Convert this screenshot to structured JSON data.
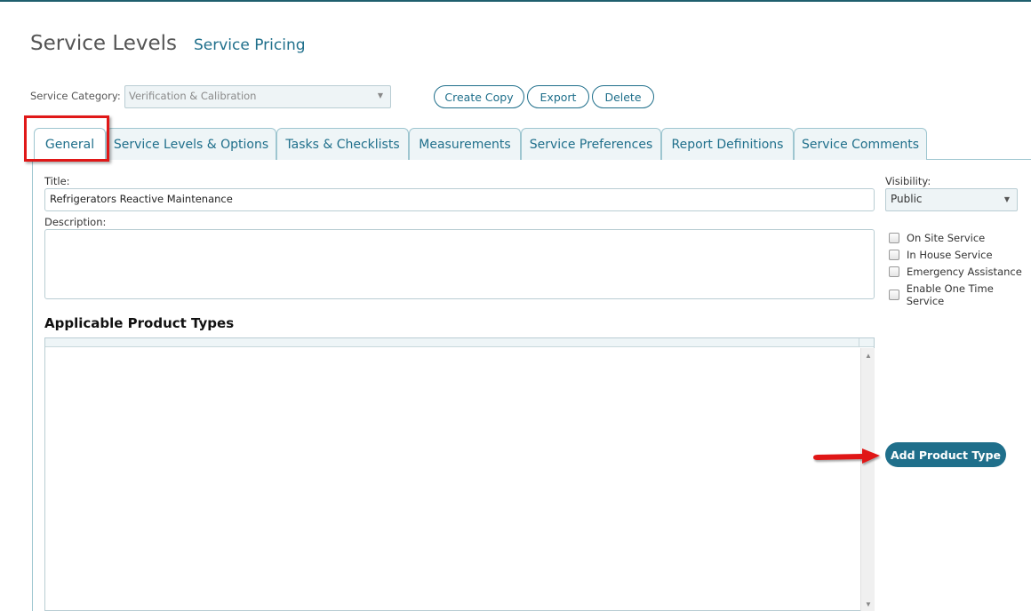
{
  "header": {
    "title": "Service Levels",
    "link": "Service Pricing"
  },
  "category": {
    "label": "Service Category:",
    "value": "Verification & Calibration"
  },
  "actions": {
    "create_copy": "Create Copy",
    "export": "Export",
    "delete": "Delete"
  },
  "tabs": [
    {
      "label": "General",
      "active": true
    },
    {
      "label": "Service Levels & Options"
    },
    {
      "label": "Tasks & Checklists"
    },
    {
      "label": "Measurements"
    },
    {
      "label": "Service Preferences"
    },
    {
      "label": "Report Definitions"
    },
    {
      "label": "Service Comments"
    }
  ],
  "form": {
    "title_label": "Title:",
    "title_value": "Refrigerators Reactive Maintenance",
    "description_label": "Description:",
    "description_value": "",
    "visibility_label": "Visibility:",
    "visibility_value": "Public"
  },
  "options": [
    {
      "label": "On Site Service",
      "checked": false
    },
    {
      "label": "In House Service",
      "checked": false
    },
    {
      "label": "Emergency Assistance",
      "checked": false
    },
    {
      "label": "Enable One Time Service",
      "checked": false
    }
  ],
  "product_types": {
    "heading": "Applicable Product Types",
    "add_button": "Add Product Type"
  },
  "icons": {
    "dropdown": "chevron-down-icon",
    "annotation": "red-arrow-icon"
  },
  "colors": {
    "accent": "#1f6f8b",
    "annotation": "#e01818"
  }
}
